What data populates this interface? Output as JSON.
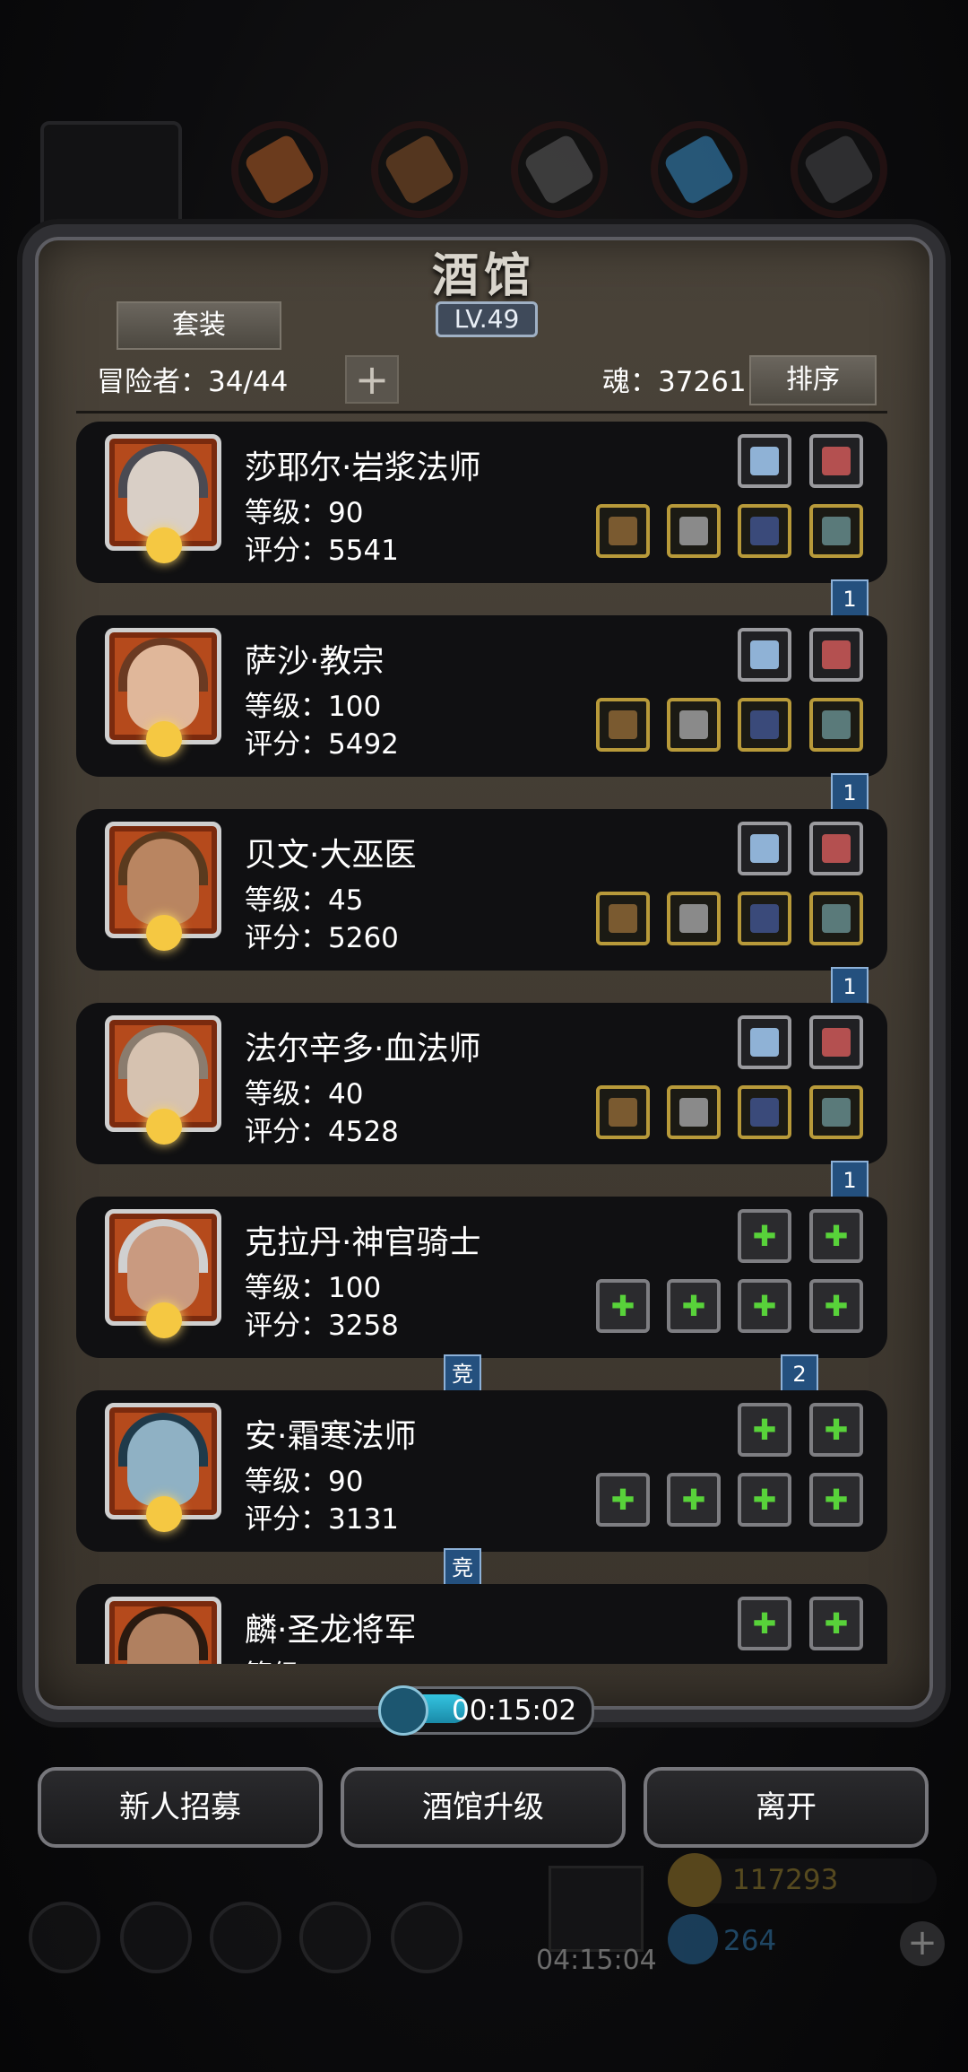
{
  "title": "酒馆",
  "level": "LV.49",
  "set_button": "套装",
  "adventurers_label": "冒险者：34/44",
  "add_label": "+",
  "soul_label": "魂：37261",
  "sort_button": "排序",
  "heroes": [
    {
      "name": "莎耶尔·岩浆法师",
      "level": "等级：90",
      "score": "评分：5541",
      "rank_badge": "1",
      "type": "geared",
      "skin": "#d9cfc6",
      "hood": "#4a4a52"
    },
    {
      "name": "萨沙·教宗",
      "level": "等级：100",
      "score": "评分：5492",
      "rank_badge": "1",
      "type": "geared",
      "skin": "#e0b79a",
      "hood": "#6b3a22"
    },
    {
      "name": "贝文·大巫医",
      "level": "等级：45",
      "score": "评分：5260",
      "rank_badge": "1",
      "type": "geared",
      "skin": "#b98561",
      "hood": "#5a3a1e"
    },
    {
      "name": "法尔辛多·血法师",
      "level": "等级：40",
      "score": "评分：4528",
      "rank_badge": "1",
      "type": "geared",
      "skin": "#d6c2b0",
      "hood": "#8a7c6e"
    },
    {
      "name": "克拉丹·神官骑士",
      "level": "等级：100",
      "score": "评分：3258",
      "rank_badge": "2",
      "mid_badge": "竞",
      "type": "empty",
      "skin": "#c99a80",
      "hood": "#d0d0d0"
    },
    {
      "name": "安·霜寒法师",
      "level": "等级：90",
      "score": "评分：3131",
      "mid_badge": "竞",
      "type": "empty",
      "skin": "#8fb1c4",
      "hood": "#1f3a4a"
    },
    {
      "name": "麟·圣龙将军",
      "level": "等级：",
      "score": "",
      "type": "empty",
      "skin": "#b08060",
      "hood": "#2a1a10"
    }
  ],
  "timer": "00:15:02",
  "buttons": {
    "recruit": "新人招募",
    "upgrade": "酒馆升级",
    "leave": "离开"
  },
  "hud": {
    "gift_timer": "04:15:04",
    "gold": "117293",
    "gems": "264",
    "add": "+"
  }
}
